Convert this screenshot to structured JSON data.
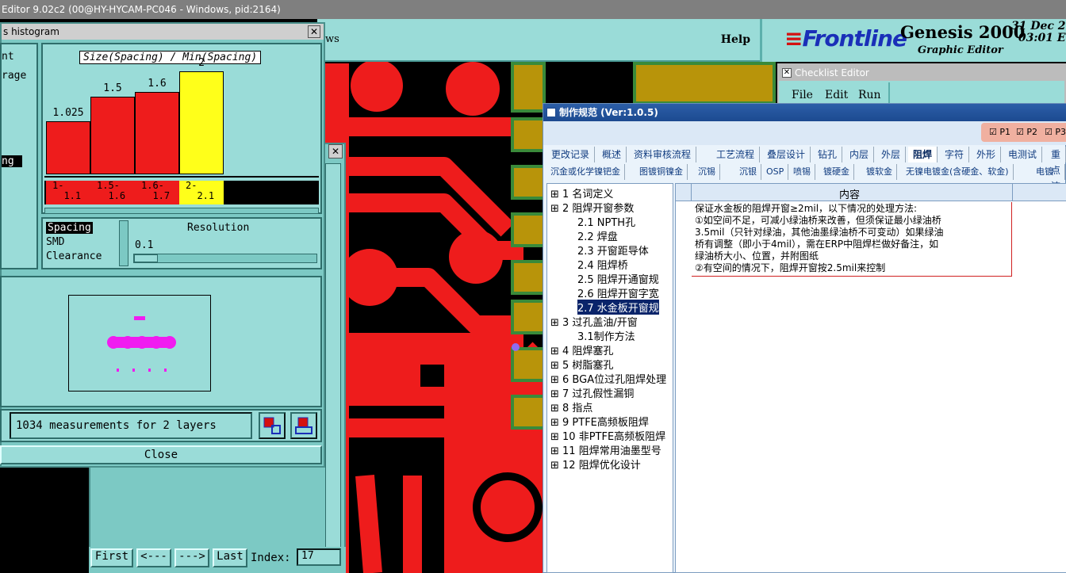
{
  "app": {
    "title": "Editor 9.02c2 (00@HY-HYCAM-PC046 - Windows, pid:2164)"
  },
  "menubar": {
    "ws_fragment": "ws",
    "help": "Help"
  },
  "brand": {
    "logo": "Frontline",
    "product": "Genesis 2000",
    "subtitle": "Graphic Editor",
    "date": "31 Dec 2",
    "time": "03:01 E"
  },
  "histogram": {
    "title": "s histogram",
    "close_x": "✕",
    "left_labels": [
      "nt",
      "rage"
    ],
    "selected_left": "ng",
    "chart_title": "Size(Spacing) / Min(Spacing)",
    "spacing_label": "Spacing",
    "smd_label": "SMD",
    "clearance_label": "Clearance",
    "resolution_label": "Resolution",
    "resolution_value": "0.1",
    "measurements": "1034 measurements for 2 layers",
    "close_button": "Close",
    "ranges": [
      "1-\n  1.1",
      "1.5-\n  1.6",
      "1.6-\n  1.7",
      "2-\n  2.1"
    ]
  },
  "chart_data": {
    "type": "bar",
    "title": "Size(Spacing) / Min(Spacing)",
    "categories": [
      "1-1.1",
      "1.5-1.6",
      "1.6-1.7",
      "2-2.1"
    ],
    "values": [
      1.025,
      1.5,
      1.6,
      2
    ],
    "value_labels": [
      "1.025",
      "1.5",
      "1.6",
      "2"
    ],
    "colors": [
      "#ee1c1c",
      "#ee1c1c",
      "#ee1c1c",
      "#ffff1a"
    ]
  },
  "nav": {
    "first": "First",
    "prev": "<---",
    "next": "--->",
    "last": "Last",
    "index_label": "Index:",
    "index_value": "17"
  },
  "checklist": {
    "title": "Checklist Editor",
    "menu": [
      "File",
      "Edit",
      "Run"
    ]
  },
  "spec": {
    "title": "制作规范 (Ver:1.0.5)",
    "checks": [
      "P1",
      "P2",
      "P3"
    ],
    "tabs1": [
      "更改记录",
      "概述",
      "资料审核流程",
      "工艺流程",
      "叠层设计",
      "钻孔",
      "内层",
      "外层",
      "阻焊",
      "字符",
      "外形",
      "电测试",
      "重点流"
    ],
    "active_tab": "阻焊",
    "tabs2": [
      "沉金或化学镍钯金",
      "图镀铜镍金",
      "沉锡",
      "沉银",
      "OSP",
      "喷锡",
      "镀硬金",
      "镀软金",
      "无镍电镀金(含硬金、软金)",
      "电镀面"
    ],
    "tree": [
      "1  名词定义",
      "2  阻焊开窗参数",
      "2.1  NPTH孔",
      "2.2  焊盘",
      "2.3  开窗距导体",
      "2.4  阻焊桥",
      "2.5  阻焊开通窗规",
      "2.6  阻焊开窗字宽",
      "2.7  水金板开窗规",
      "3  过孔盖油/开窗",
      "3.1制作方法",
      "4  阻焊塞孔",
      "5  树脂塞孔",
      "6  BGA位过孔阻焊处理",
      "7  过孔假性漏铜",
      "8  指点",
      "9  PTFE高频板阻焊",
      "10  非PTFE高频板阻焊",
      "11  阻焊常用油墨型号",
      "12  阻焊优化设计"
    ],
    "content_header": "内容",
    "content_lines": [
      "保证水金板的阻焊开窗≥2mil，以下情况的处理方法:",
      "①如空间不足，可减小绿油桥来改善，但须保证最小绿油桥",
      "3.5mil（只针对绿油，其他油墨绿油桥不可变动）如果绿油",
      "桥有调整（即小于4mil），需在ERP中阻焊栏做好备注，如",
      "绿油桥大小、位置，并附图纸",
      "②有空间的情况下，阻焊开窗按2.5mil来控制"
    ]
  }
}
